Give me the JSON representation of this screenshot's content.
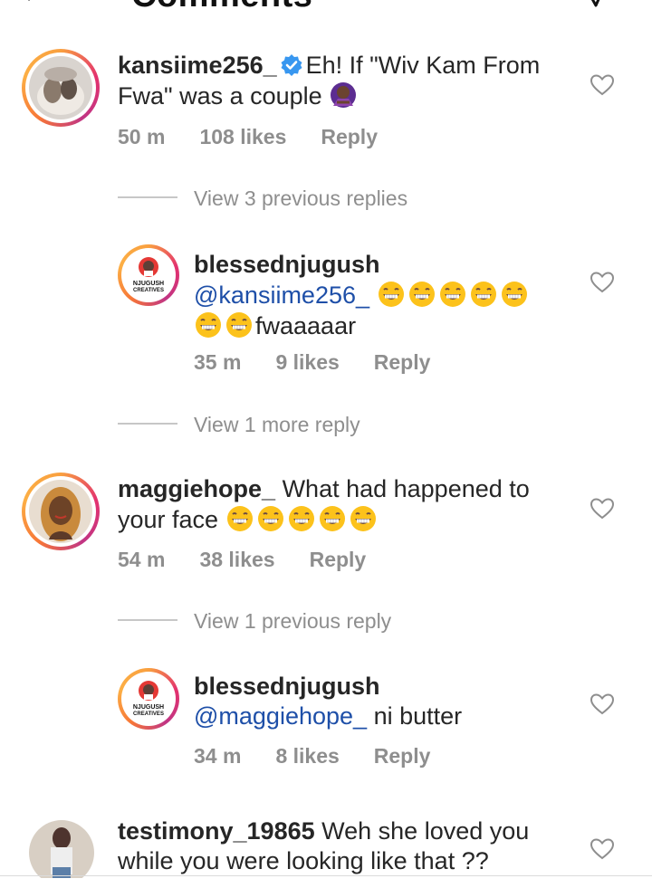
{
  "header": {
    "title": "Comments"
  },
  "comments": [
    {
      "username": "kansiime256_",
      "verified": true,
      "line1": "Eh! If \"Wiv Kam From",
      "line2": "Fwa\" was a couple",
      "time": "50 m",
      "likes": "108 likes",
      "reply": "Reply"
    },
    {
      "view_replies": "View 3 previous replies"
    },
    {
      "username": "blessednjugush",
      "mention": "@kansiime256_",
      "text": "fwaaaaar",
      "time": "35 m",
      "likes": "9 likes",
      "reply": "Reply",
      "avatar_text": "NJUGUSH CREATIVES"
    },
    {
      "view_replies": "View 1 more reply"
    },
    {
      "username": "maggiehope_",
      "line1": "What had happened to",
      "line2": "your face",
      "time": "54 m",
      "likes": "38 likes",
      "reply": "Reply"
    },
    {
      "view_replies": "View 1 previous reply"
    },
    {
      "username": "blessednjugush",
      "mention": "@maggiehope_",
      "text": "ni butter",
      "time": "34 m",
      "likes": "8 likes",
      "reply": "Reply",
      "avatar_text": "NJUGUSH CREATIVES"
    },
    {
      "username": "testimony_19865",
      "line1": "Weh she loved you",
      "line2": "while you were looking like that ??"
    }
  ],
  "colors": {
    "mention": "#1e4fa8",
    "muted": "#8e8e8e",
    "ring": "#e3326e"
  },
  "icons": [
    "back-arrow-icon",
    "send-icon",
    "heart-icon",
    "verified-badge-icon",
    "laughing-emoji-icon",
    "woman-gesturing-no-emoji-icon"
  ]
}
